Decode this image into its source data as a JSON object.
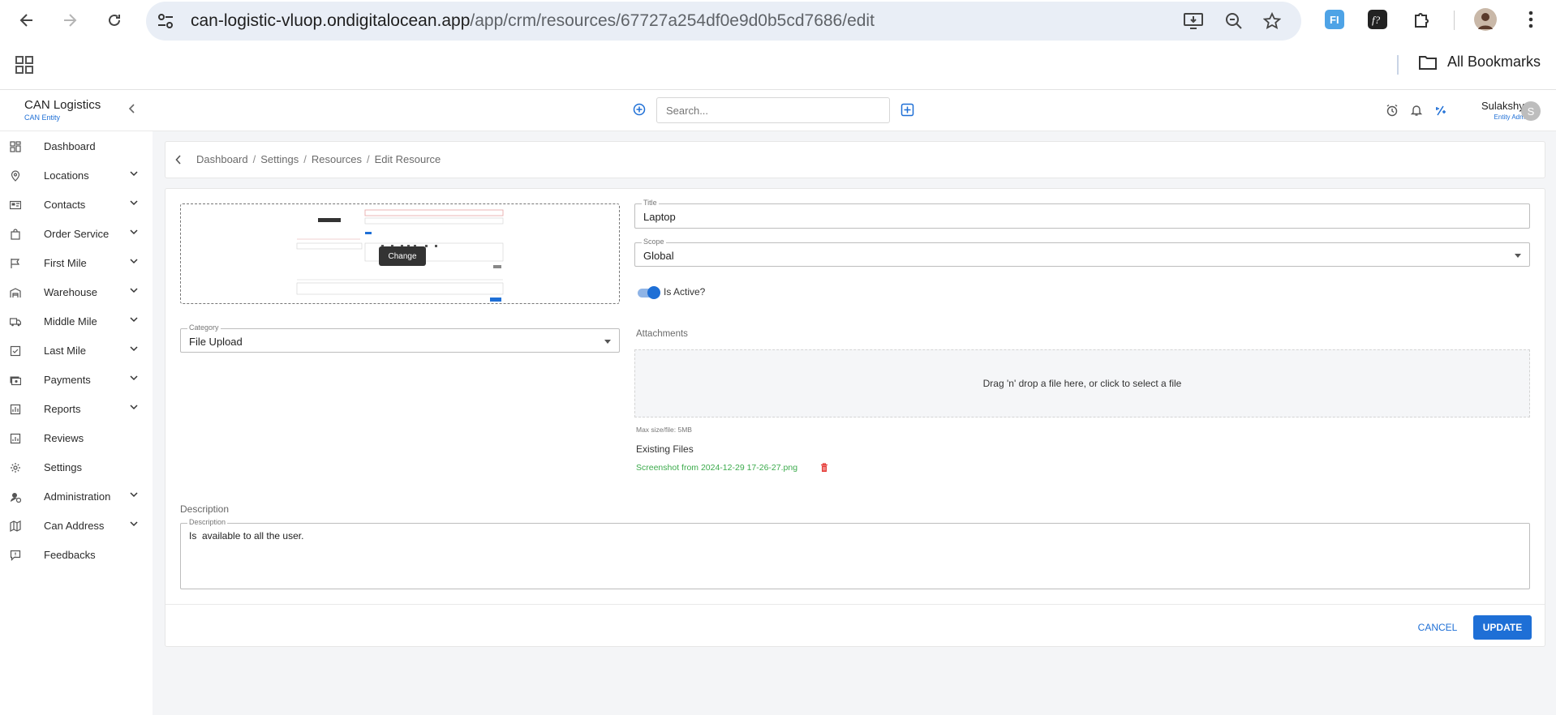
{
  "browser": {
    "url_host": "can-logistic-vluop.ondigitalocean.app",
    "url_path": "/app/crm/resources/67727a254df0e9d0b5cd7686/edit",
    "bookmarks_label": "All Bookmarks"
  },
  "header": {
    "brand": "CAN Logistics",
    "brand_sub": "CAN Entity",
    "search_placeholder": "Search...",
    "user_name": "Sulakshya",
    "user_role": "Entity Admin",
    "avatar_initial": "S"
  },
  "sidebar": {
    "items": [
      {
        "label": "Dashboard",
        "icon": "dashboard-icon",
        "expandable": false
      },
      {
        "label": "Locations",
        "icon": "location-pin-icon",
        "expandable": true
      },
      {
        "label": "Contacts",
        "icon": "contact-card-icon",
        "expandable": true
      },
      {
        "label": "Order Service",
        "icon": "shopping-bag-icon",
        "expandable": true
      },
      {
        "label": "First Mile",
        "icon": "flag-icon",
        "expandable": true
      },
      {
        "label": "Warehouse",
        "icon": "warehouse-icon",
        "expandable": true
      },
      {
        "label": "Middle Mile",
        "icon": "truck-icon",
        "expandable": true
      },
      {
        "label": "Last Mile",
        "icon": "checklist-icon",
        "expandable": true
      },
      {
        "label": "Payments",
        "icon": "payments-icon",
        "expandable": true
      },
      {
        "label": "Reports",
        "icon": "reports-icon",
        "expandable": true
      },
      {
        "label": "Reviews",
        "icon": "reviews-icon",
        "expandable": false
      },
      {
        "label": "Settings",
        "icon": "gear-icon",
        "expandable": false
      },
      {
        "label": "Administration",
        "icon": "admin-icon",
        "expandable": true
      },
      {
        "label": "Can Address",
        "icon": "map-icon",
        "expandable": true
      },
      {
        "label": "Feedbacks",
        "icon": "feedback-icon",
        "expandable": false
      }
    ]
  },
  "breadcrumb": {
    "items": [
      "Dashboard",
      "Settings",
      "Resources",
      "Edit Resource"
    ],
    "separator": "/"
  },
  "form": {
    "change_label": "Change",
    "category": {
      "label": "Category",
      "value": "File Upload"
    },
    "title": {
      "label": "Title",
      "value": "Laptop"
    },
    "scope": {
      "label": "Scope",
      "value": "Global"
    },
    "is_active": {
      "label": "Is Active?",
      "checked": true
    },
    "attachments_label": "Attachments",
    "dropzone_text": "Drag 'n' drop a file here, or click to select a file",
    "max_size": "Max size/file: 5MB",
    "existing_files_label": "Existing Files",
    "existing_file": "Screenshot from 2024-12-29 17-26-27.png",
    "description_heading": "Description",
    "description": {
      "label": "Description",
      "value": "Is  available to all the user."
    },
    "cancel_label": "CANCEL",
    "update_label": "UPDATE"
  },
  "colors": {
    "accent": "#1e6fd6",
    "link_green": "#3cab4c",
    "danger": "#e53935",
    "page_bg": "#f4f5f7"
  }
}
